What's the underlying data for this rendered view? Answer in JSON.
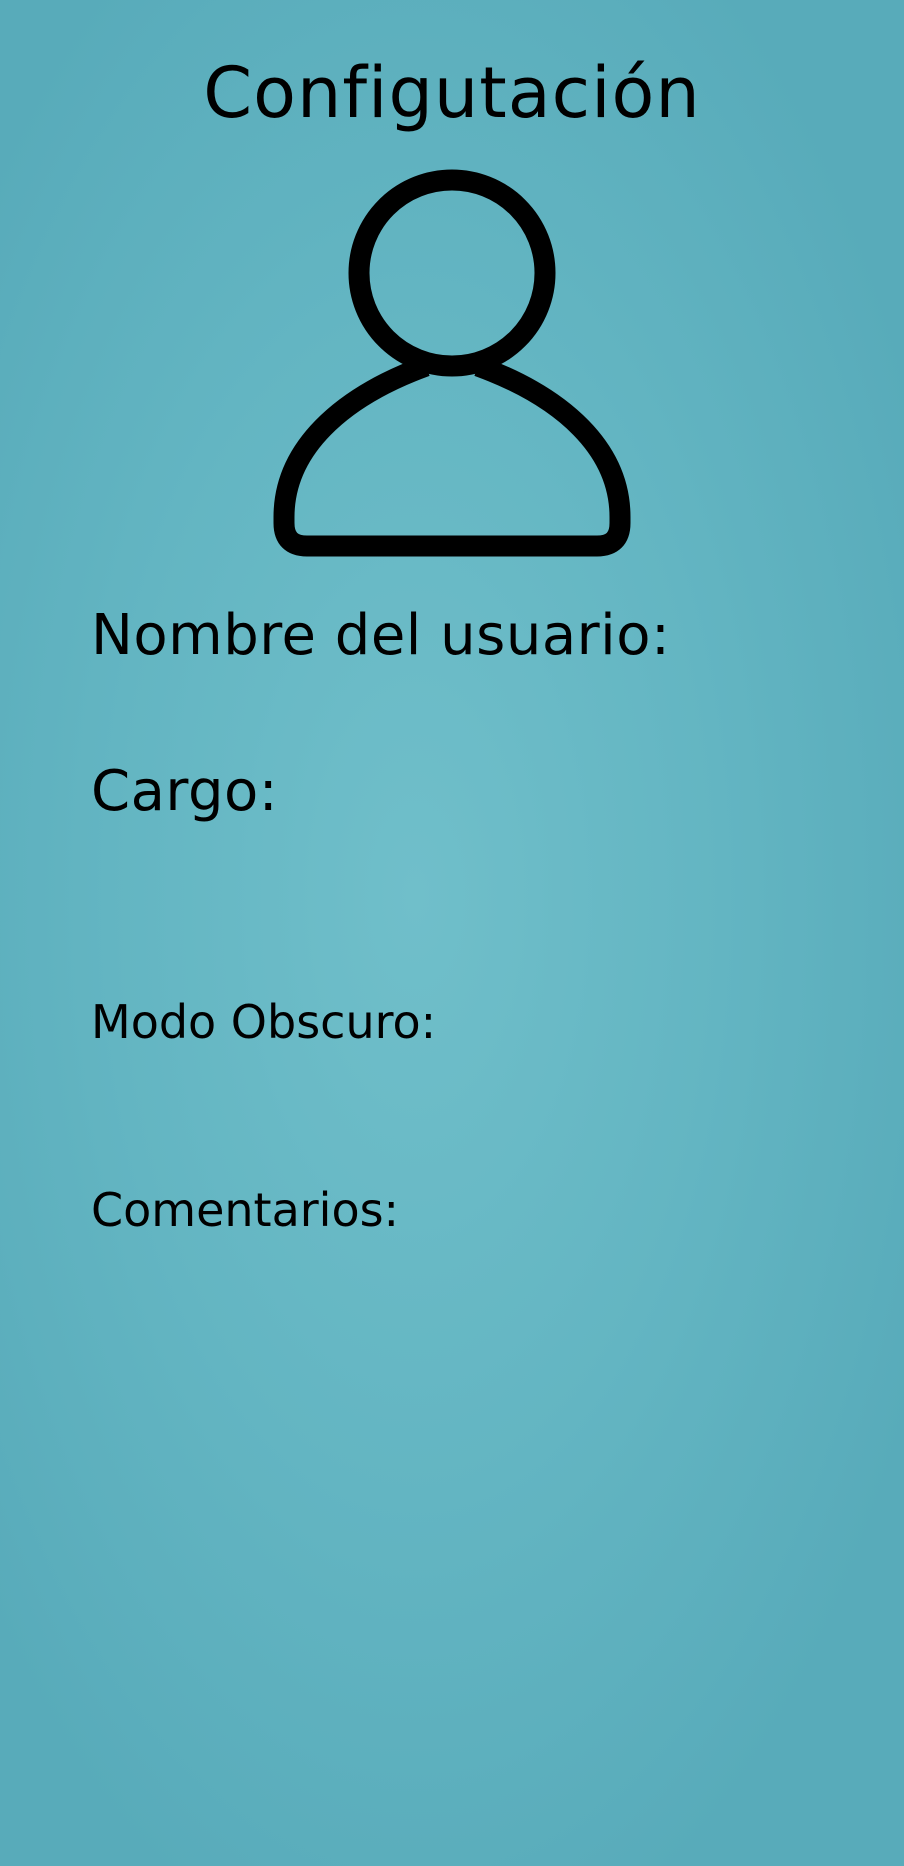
{
  "header": {
    "title": "Configutación"
  },
  "profile": {
    "avatar_icon": "user-icon"
  },
  "fields": {
    "user_name_label": "Nombre del usuario:",
    "role_label": "Cargo:",
    "dark_mode_label": "Modo Obscuro:",
    "comments_label": "Comentarios:"
  },
  "colors": {
    "background": "#63b5c2",
    "text": "#000000"
  }
}
